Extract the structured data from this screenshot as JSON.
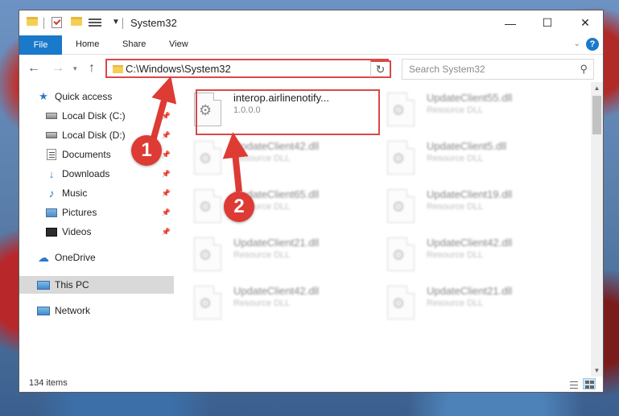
{
  "window": {
    "title": "System32",
    "minimize_glyph": "—",
    "maximize_glyph": "☐",
    "close_glyph": "✕"
  },
  "ribbon": {
    "tabs": [
      "File",
      "Home",
      "Share",
      "View"
    ],
    "help_glyph": "?",
    "expand_glyph": "⌄"
  },
  "navbar": {
    "back_glyph": "←",
    "forward_glyph": "→",
    "recent_glyph": "▾",
    "up_glyph": "↑",
    "address_path": "C:\\Windows\\System32",
    "address_dropdown_glyph": "⌄",
    "refresh_glyph": "↻",
    "search_placeholder": "Search System32",
    "search_glyph": "⚲"
  },
  "sidebar": {
    "items": [
      {
        "label": "Quick access",
        "icon": "star-icon",
        "pinned": false
      },
      {
        "label": "Local Disk (C:)",
        "icon": "drive-icon",
        "pinned": true
      },
      {
        "label": "Local Disk (D:)",
        "icon": "drive-icon",
        "pinned": true
      },
      {
        "label": "Documents",
        "icon": "documents-icon",
        "pinned": true
      },
      {
        "label": "Downloads",
        "icon": "download-icon",
        "pinned": true
      },
      {
        "label": "Music",
        "icon": "music-icon",
        "pinned": true
      },
      {
        "label": "Pictures",
        "icon": "pictures-icon",
        "pinned": true
      },
      {
        "label": "Videos",
        "icon": "videos-icon",
        "pinned": true
      },
      {
        "label": "OneDrive",
        "icon": "cloud-icon",
        "pinned": false
      },
      {
        "label": "This PC",
        "icon": "pc-icon",
        "pinned": false,
        "selected": true
      },
      {
        "label": "Network",
        "icon": "network-icon",
        "pinned": false
      }
    ],
    "pin_glyph": "📌"
  },
  "files": [
    {
      "name": "interop.airlinenotify...",
      "sub": "1.0.0.0",
      "highlighted": true
    },
    {
      "name": "UpdateClient55.dll",
      "sub": "Resource DLL"
    },
    {
      "name": "UpdateClient42.dll",
      "sub": "Resource DLL"
    },
    {
      "name": "UpdateClient5.dll",
      "sub": "Resource DLL"
    },
    {
      "name": "UpdateClient65.dll",
      "sub": "Resource DLL"
    },
    {
      "name": "UpdateClient19.dll",
      "sub": "Resource DLL"
    },
    {
      "name": "UpdateClient21.dll",
      "sub": "Resource DLL"
    },
    {
      "name": "UpdateClient42.dll",
      "sub": "Resource DLL"
    },
    {
      "name": "UpdateClient42.dll",
      "sub": "Resource DLL"
    },
    {
      "name": "UpdateClient21.dll",
      "sub": "Resource DLL"
    }
  ],
  "status": {
    "item_count": "134 items"
  },
  "annotations": {
    "step1": "1",
    "step2": "2",
    "color": "#dd3b34"
  }
}
